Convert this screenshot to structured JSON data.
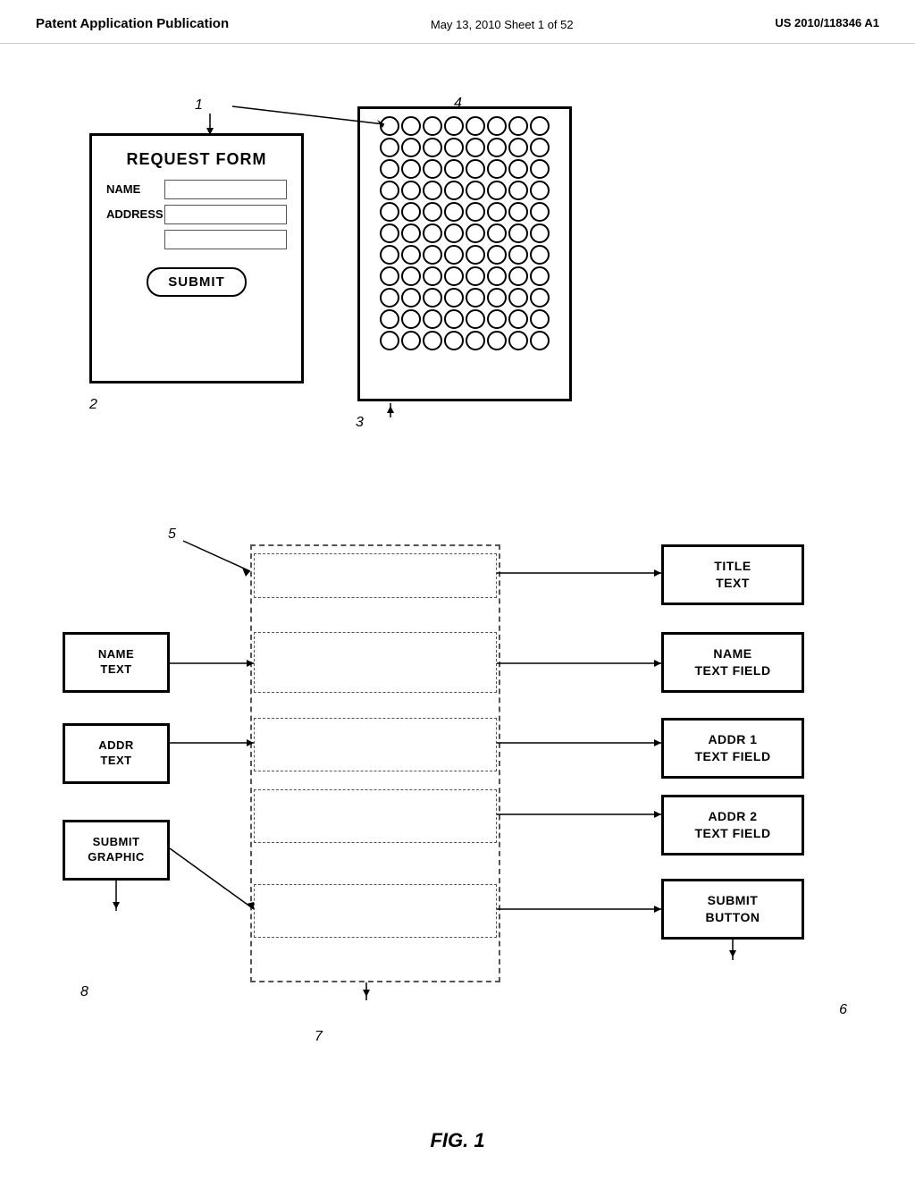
{
  "header": {
    "left_label": "Patent Application Publication",
    "center_label": "May 13, 2010   Sheet 1 of 52",
    "right_label": "US 2010/118346 A1"
  },
  "top_diagram": {
    "label_1": "1",
    "label_2": "2",
    "label_3": "3",
    "label_4": "4",
    "form_title": "REQUEST FORM",
    "name_label": "NAME",
    "address_label": "ADDRESS",
    "submit_label": "SUBMIT",
    "grid_rows": 11,
    "grid_cols": 8
  },
  "bottom_diagram": {
    "label_5": "5",
    "label_6": "6",
    "label_7": "7",
    "label_8": "8",
    "right_components": [
      {
        "id": "title-text-box",
        "text": "TITLE\nTEXT"
      },
      {
        "id": "name-text-field-box",
        "text": "NAME\nTEXT FIELD"
      },
      {
        "id": "addr1-text-field-box",
        "text": "ADDR 1\nTEXT FIELD"
      },
      {
        "id": "addr2-text-field-box",
        "text": "ADDR 2\nTEXT FIELD"
      },
      {
        "id": "submit-button-box",
        "text": "SUBMIT\nBUTTON"
      }
    ],
    "left_components": [
      {
        "id": "name-text-box",
        "text": "NAME\nTEXT"
      },
      {
        "id": "addr-text-box",
        "text": "ADDR\nTEXT"
      },
      {
        "id": "submit-graphic-box",
        "text": "SUBMIT\nGRAPHIC"
      }
    ]
  },
  "figure_caption": "FIG. 1"
}
